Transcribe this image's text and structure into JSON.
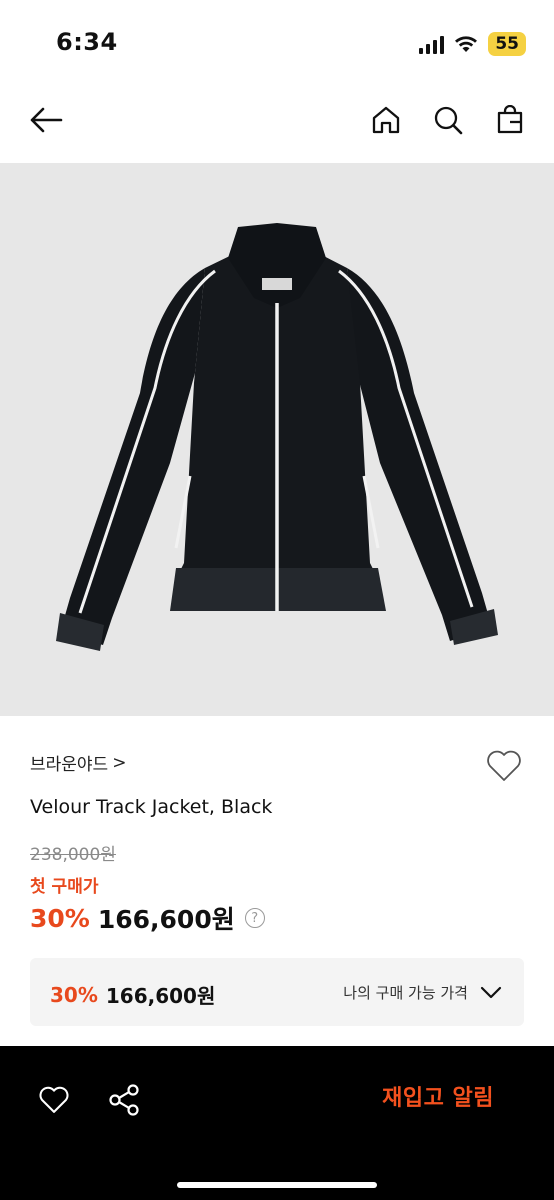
{
  "status_bar": {
    "time": "6:34",
    "battery": "55",
    "battery_color": "#f5d142"
  },
  "nav": {
    "back_icon": "arrow-left-icon",
    "home_icon": "home-icon",
    "search_icon": "search-icon",
    "cart_icon": "shopping-bag-icon"
  },
  "product": {
    "brand": "브라운야드",
    "brand_chevron": ">",
    "name": "Velour Track Jacket, Black",
    "original_price": "238,000원",
    "first_buy_label": "첫 구매가",
    "discount": "30%",
    "sale_price": "166,600원",
    "help": "?"
  },
  "my_price": {
    "discount": "30%",
    "price": "166,600원",
    "label": "나의 구매 가능 가격"
  },
  "bottom_bar": {
    "restock_label": "재입고 알림",
    "accent_color": "#f4511e"
  },
  "colors": {
    "accent": "#e8491d",
    "image_bg": "#e7e7e7",
    "box_bg": "#f4f4f4"
  }
}
